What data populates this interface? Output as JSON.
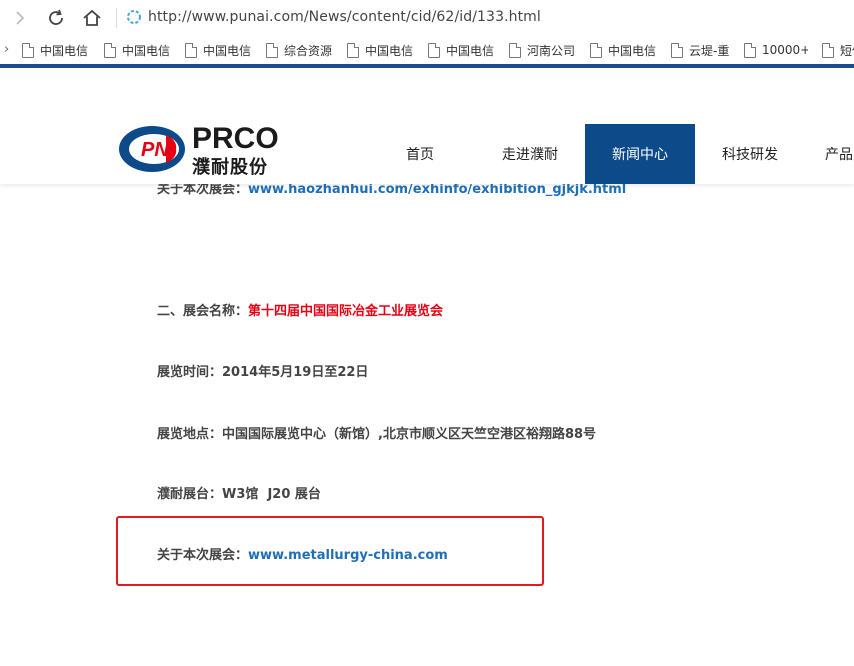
{
  "browser": {
    "url": "http://www.punai.com/News/content/cid/62/id/133.html"
  },
  "bookmarks": [
    {
      "label": "中国电信"
    },
    {
      "label": "中国电信"
    },
    {
      "label": "中国电信"
    },
    {
      "label": "综合资源"
    },
    {
      "label": "中国电信"
    },
    {
      "label": "中国电信"
    },
    {
      "label": "河南公司"
    },
    {
      "label": "中国电信"
    },
    {
      "label": "云堤-重"
    },
    {
      "label": "10000+"
    },
    {
      "label": "短信"
    }
  ],
  "site": {
    "logo_mark": "PN",
    "logo_brand": "PRCO",
    "logo_cn": "濮耐股份",
    "menu": [
      {
        "label": "首页"
      },
      {
        "label": "走进濮耐"
      },
      {
        "label": "新闻中心",
        "active": true
      },
      {
        "label": "科技研发"
      },
      {
        "label": "产品"
      }
    ]
  },
  "article": {
    "partial_line": {
      "label": "关于本次展会：",
      "link": "www.haozhanhui.com/exhinfo/exhibition_gjkjk.html"
    },
    "exhibition_name": {
      "label": "二、展会名称：",
      "value": "第十四届中国国际冶金工业展览会"
    },
    "time": {
      "label": "展览时间：",
      "value": "2014年5月19日至22日"
    },
    "location": {
      "label": "展览地点：",
      "value": "中国国际展览中心（新馆）,北京市顺义区天竺空港区裕翔路88号"
    },
    "booth": {
      "label": "濮耐展台：",
      "value": "W3馆  J20 展台"
    },
    "about": {
      "label": "关于本次展会：",
      "link": "www.metallurgy-china.com"
    }
  },
  "colors": {
    "brand_blue": "#0d4a8a",
    "link_blue": "#1f6fb8",
    "highlight_red": "#e60012"
  }
}
